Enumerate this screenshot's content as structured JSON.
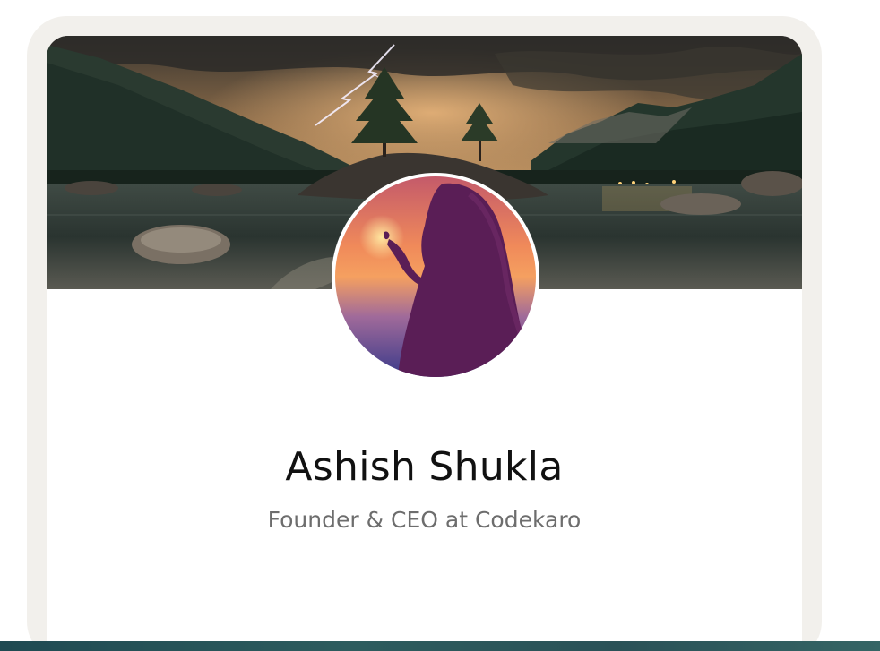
{
  "profile": {
    "name": "Ashish Shukla",
    "role": "Founder & CEO at Codekaro"
  },
  "images": {
    "cover": "cover-photo-mountain-lake-storm",
    "avatar": "profile-photo-silhouette-sunset"
  },
  "colors": {
    "frame": "#f2f0ec",
    "name_text": "#111111",
    "role_text": "#6d6d6d",
    "bottom_strip": "#2d5c5e"
  }
}
